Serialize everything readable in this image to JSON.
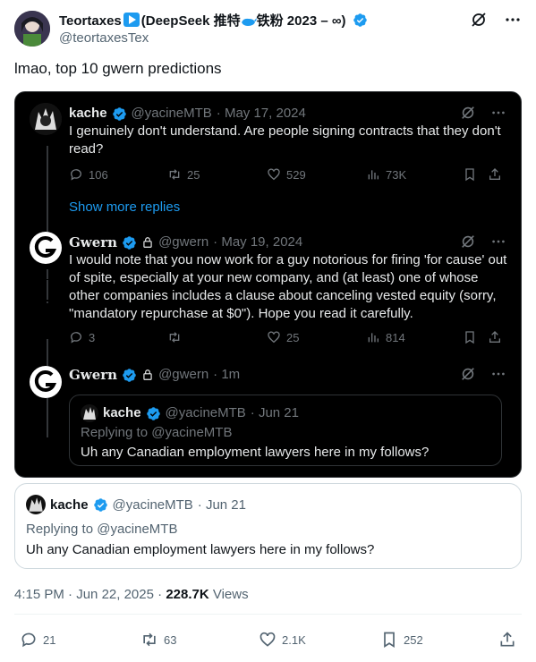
{
  "author": {
    "name_prefix": "Teortaxes",
    "name_mid": "(DeepSeek 推特",
    "name_suffix": "铁粉 2023 – ∞)",
    "handle": "@teortaxesTex"
  },
  "tweet": {
    "text": "lmao, top 10 gwern predictions",
    "time": "4:15 PM",
    "date": "Jun 22, 2025",
    "views_count": "228.7K",
    "views_label": "Views",
    "replies": "21",
    "retweets": "63",
    "likes": "2.1K",
    "bookmarks": "252"
  },
  "screenshot": {
    "post1": {
      "name": "kache",
      "handle": "@yacineMTB",
      "date": "· May 17, 2024",
      "text": "I genuinely don't understand. Are people signing contracts that they don't read?",
      "replies": "106",
      "retweets": "25",
      "likes": "529",
      "views": "73K"
    },
    "show_more": "Show more replies",
    "post2": {
      "name": "Gwern",
      "handle": "@gwern",
      "date": "· May 19, 2024",
      "text": "I would note that you now work for a guy notorious for firing 'for cause' out of spite, especially at your new company, and (at least) one of whose other companies includes a clause about canceling vested equity (sorry, \"mandatory repurchase at $0\"). Hope you read it carefully.",
      "replies": "3",
      "likes": "25",
      "views": "814"
    },
    "post3": {
      "name": "Gwern",
      "handle": "@gwern",
      "date": "· 1m"
    },
    "inner_quote": {
      "name": "kache",
      "handle": "@yacineMTB",
      "date": "· Jun 21",
      "replying": "Replying to @yacineMTB",
      "text": "Uh any Canadian employment lawyers here in my follows?"
    }
  },
  "quote": {
    "name": "kache",
    "handle": "@yacineMTB",
    "date": "· Jun 21",
    "replying": "Replying to @yacineMTB",
    "text": "Uh any Canadian employment lawyers here in my follows?"
  },
  "colors": {
    "accent": "#1d9bf0",
    "muted": "#536471",
    "dark_bg": "#000000"
  }
}
